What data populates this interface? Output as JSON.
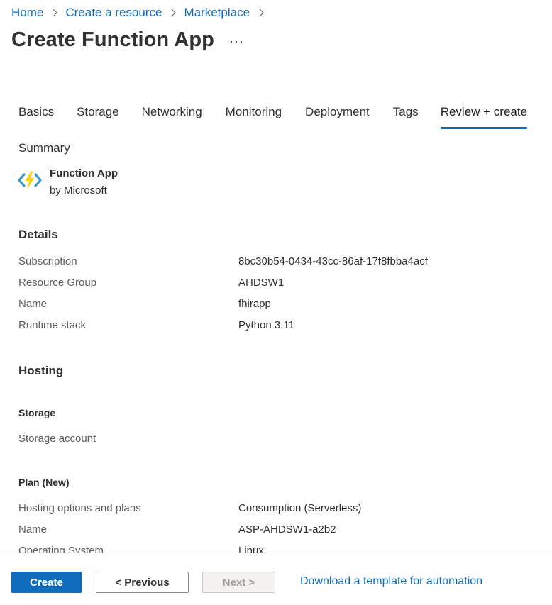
{
  "breadcrumb": [
    {
      "label": "Home"
    },
    {
      "label": "Create a resource"
    },
    {
      "label": "Marketplace"
    }
  ],
  "page": {
    "title": "Create Function App",
    "more": "···"
  },
  "tabs": [
    {
      "label": "Basics",
      "active": false
    },
    {
      "label": "Storage",
      "active": false
    },
    {
      "label": "Networking",
      "active": false
    },
    {
      "label": "Monitoring",
      "active": false
    },
    {
      "label": "Deployment",
      "active": false
    },
    {
      "label": "Tags",
      "active": false
    },
    {
      "label": "Review + create",
      "active": true
    }
  ],
  "summary": {
    "label": "Summary",
    "app_name": "Function App",
    "publisher": "by Microsoft",
    "icon": "function-app-icon"
  },
  "details": {
    "title": "Details",
    "rows": [
      {
        "key": "Subscription",
        "value": "8bc30b54-0434-43cc-86af-17f8fbba4acf"
      },
      {
        "key": "Resource Group",
        "value": "AHDSW1"
      },
      {
        "key": "Name",
        "value": "fhirapp"
      },
      {
        "key": "Runtime stack",
        "value": "Python 3.11"
      }
    ]
  },
  "hosting": {
    "title": "Hosting",
    "storage": {
      "title": "Storage",
      "rows": [
        {
          "key": "Storage account",
          "value": ""
        }
      ]
    },
    "plan": {
      "title": "Plan (New)",
      "rows": [
        {
          "key": "Hosting options and plans",
          "value": "Consumption (Serverless)"
        },
        {
          "key": "Name",
          "value": "ASP-AHDSW1-a2b2"
        },
        {
          "key": "Operating System",
          "value": "Linux"
        }
      ]
    }
  },
  "footer": {
    "create": "Create",
    "previous": "< Previous",
    "next": "Next >",
    "download": "Download a template for automation"
  },
  "colors": {
    "accent": "#0f6cbd",
    "text": "#323130",
    "muted": "#605e5c",
    "icon_blue": "#3999c6",
    "icon_yellow": "#fcd116"
  }
}
